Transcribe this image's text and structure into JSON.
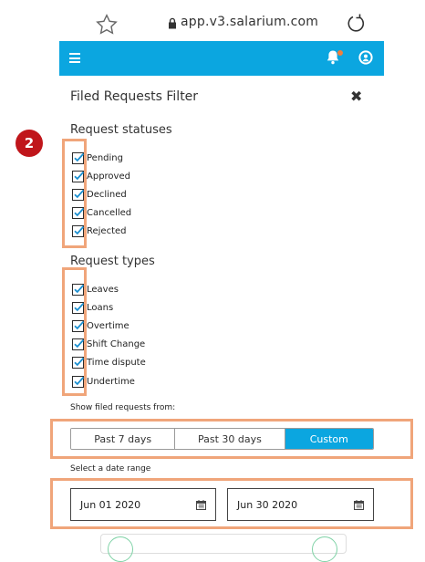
{
  "browser": {
    "url": "app.v3.salarium.com"
  },
  "icons": {
    "star": "star-icon",
    "lock": "lock-icon",
    "reload": "reload-icon",
    "menu": "hamburger-menu-icon",
    "bell": "bell-icon",
    "user": "user-icon",
    "close": "close-icon",
    "calendar": "calendar-icon",
    "check": "checkmark-icon"
  },
  "colors": {
    "appbar": "#0ba6e0",
    "highlight": "#f0a57a",
    "badge": "#c0161b",
    "notif_dot": "#f07f3c"
  },
  "filter": {
    "title": "Filed Requests Filter",
    "close_symbol": "✖",
    "badge_number": "2",
    "statuses_heading": "Request statuses",
    "statuses": [
      {
        "label": "Pending",
        "checked": true
      },
      {
        "label": "Approved",
        "checked": true
      },
      {
        "label": "Declined",
        "checked": true
      },
      {
        "label": "Cancelled",
        "checked": true
      },
      {
        "label": "Rejected",
        "checked": true
      }
    ],
    "types_heading": "Request types",
    "types": [
      {
        "label": "Leaves",
        "checked": true
      },
      {
        "label": "Loans",
        "checked": true
      },
      {
        "label": "Overtime",
        "checked": true
      },
      {
        "label": "Shift Change",
        "checked": true
      },
      {
        "label": "Time dispute",
        "checked": true
      },
      {
        "label": "Undertime",
        "checked": true
      }
    ],
    "show_from_label": "Show filed requests from:",
    "periods": [
      "Past 7 days",
      "Past 30 days",
      "Custom"
    ],
    "selected_period": "Custom",
    "date_range_label": "Select a date range",
    "date_from": "Jun 01 2020",
    "date_to": "Jun 30 2020"
  }
}
